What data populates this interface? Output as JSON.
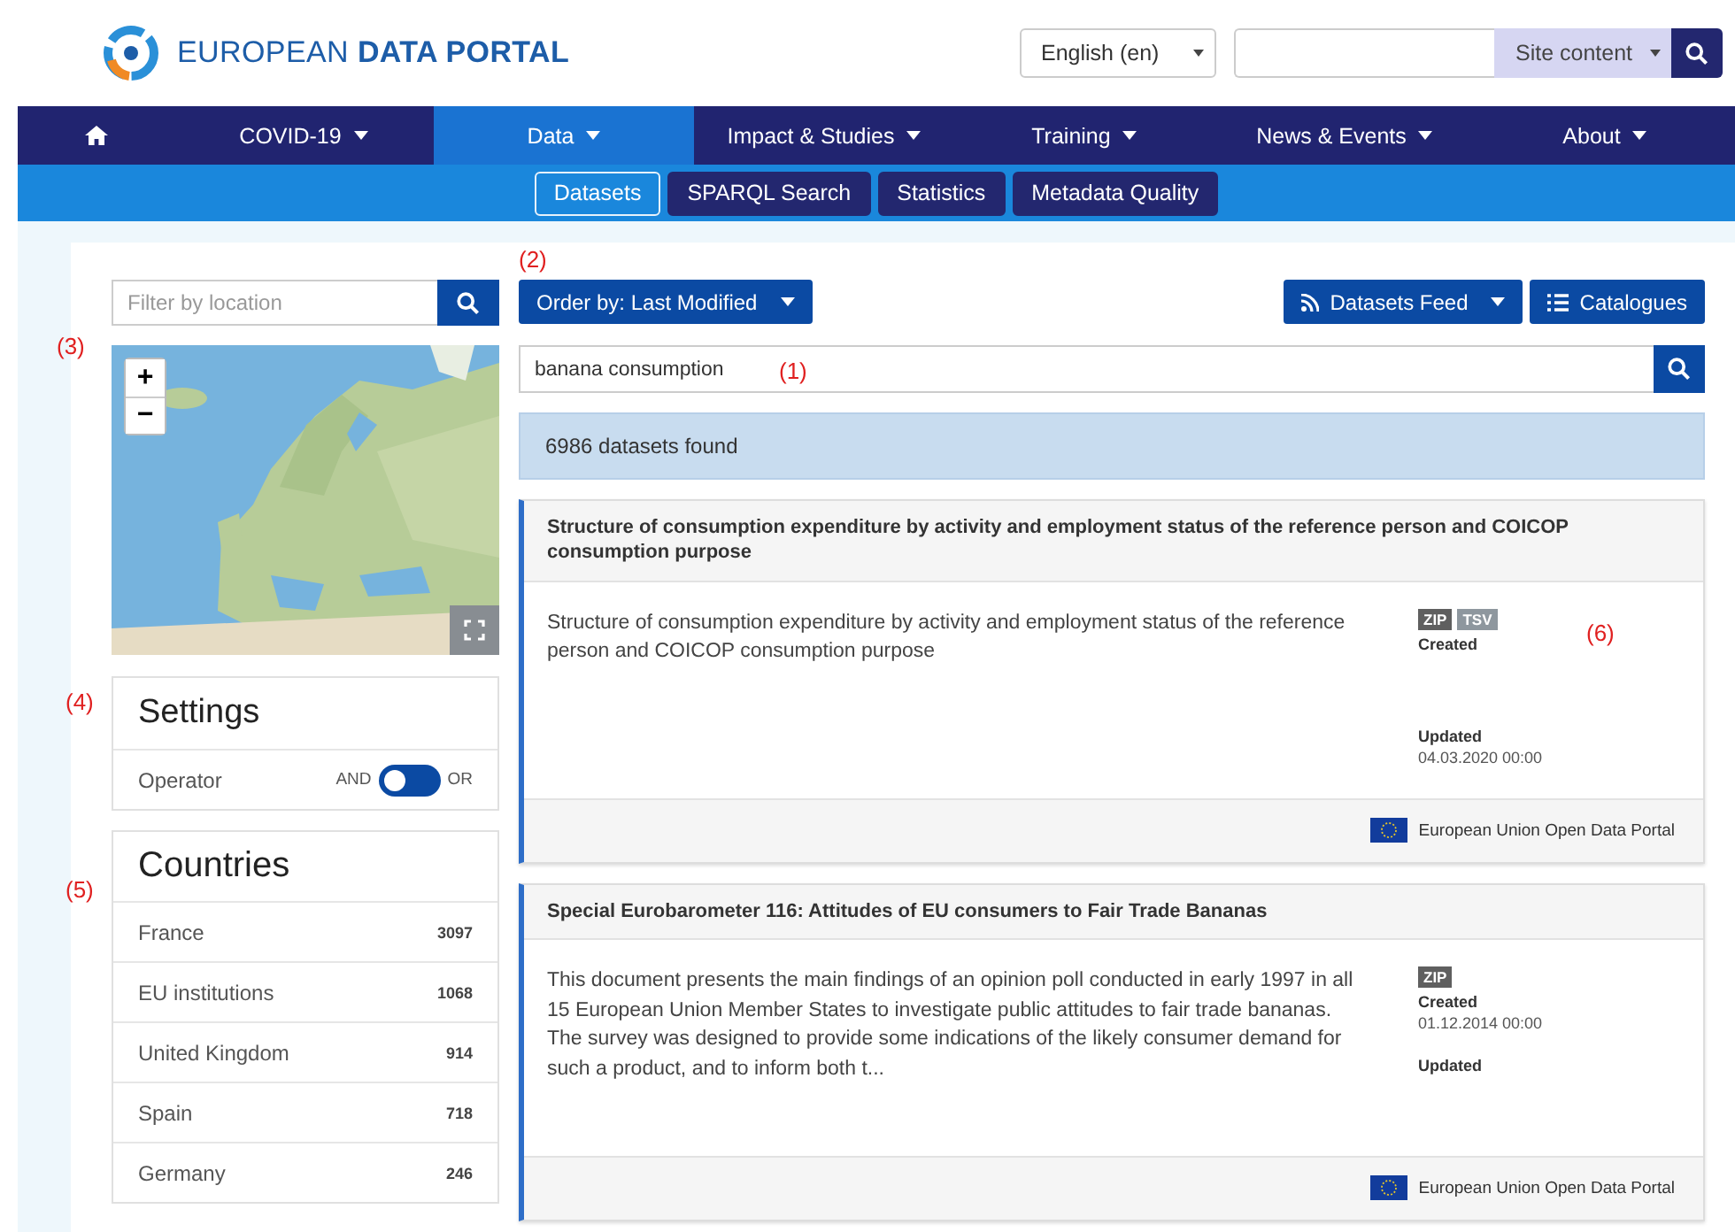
{
  "header": {
    "logo_light": "EUROPEAN",
    "logo_bold": "DATA PORTAL",
    "language": "English (en)",
    "search_scope": "Site content"
  },
  "nav": [
    {
      "kind": "home",
      "selected": false
    },
    {
      "kind": "menu",
      "label": "COVID-19",
      "selected": false
    },
    {
      "kind": "menu",
      "label": "Data",
      "selected": true
    },
    {
      "kind": "menu",
      "label": "Impact & Studies",
      "selected": false
    },
    {
      "kind": "menu",
      "label": "Training",
      "selected": false
    },
    {
      "kind": "menu",
      "label": "News & Events",
      "selected": false
    },
    {
      "kind": "menu",
      "label": "About",
      "selected": false
    }
  ],
  "subnav": [
    {
      "label": "Datasets",
      "selected": true
    },
    {
      "label": "SPARQL Search",
      "selected": false
    },
    {
      "label": "Statistics",
      "selected": false
    },
    {
      "label": "Metadata Quality",
      "selected": false
    }
  ],
  "sidebar": {
    "location_placeholder": "Filter by location",
    "map": {
      "kind": "picture",
      "zoom_in": "+",
      "zoom_out": "−"
    },
    "settings": {
      "title": "Settings",
      "operator_label": "Operator",
      "and_label": "AND",
      "or_label": "OR",
      "or_selected": false
    },
    "countries": {
      "title": "Countries",
      "items": [
        {
          "name": "France",
          "count": "3097"
        },
        {
          "name": "EU institutions",
          "count": "1068"
        },
        {
          "name": "United Kingdom",
          "count": "914"
        },
        {
          "name": "Spain",
          "count": "718"
        },
        {
          "name": "Germany",
          "count": "246"
        }
      ]
    }
  },
  "main": {
    "order_button": "Order by: Last Modified",
    "feed_button": "Datasets Feed",
    "catalogues_button": "Catalogues",
    "search_value": "banana consumption",
    "result_count": "6986 datasets found",
    "datasets": [
      {
        "title": "Structure of consumption expenditure by activity and employment status of the reference person and COICOP consumption purpose",
        "description": "Structure of consumption expenditure by activity and employment status of the reference person and COICOP consumption purpose",
        "formats": [
          {
            "label": "ZIP",
            "color": "#5f5f5f"
          },
          {
            "label": "TSV",
            "color": "#8e979e"
          }
        ],
        "created_label": "Created",
        "updated_label": "Updated",
        "updated_date": "04.03.2020 00:00",
        "publisher": "European Union Open Data Portal"
      },
      {
        "title": "Special Eurobarometer 116: Attitudes of EU consumers to Fair Trade Bananas",
        "description": "This document presents the main findings of an opinion poll conducted in early 1997 in all 15 European Union Member States to investigate public attitudes to fair trade bananas. The survey was designed to provide some indications of the likely consumer demand for such a product, and to inform both t...",
        "formats": [
          {
            "label": "ZIP",
            "color": "#5f5f5f"
          }
        ],
        "created_label": "Created",
        "created_date": "01.12.2014 00:00",
        "updated_label": "Updated",
        "publisher": "European Union Open Data Portal"
      }
    ]
  },
  "annotations": [
    {
      "text": "(1)"
    },
    {
      "text": "(2)"
    },
    {
      "text": "(3)"
    },
    {
      "text": "(4)"
    },
    {
      "text": "(5)"
    },
    {
      "text": "(6)"
    }
  ]
}
